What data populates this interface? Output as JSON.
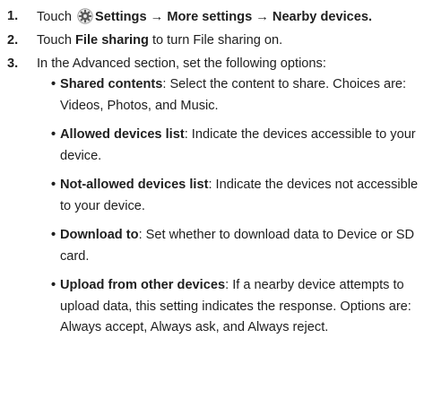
{
  "steps": [
    {
      "number": "1.",
      "parts": [
        "Touch",
        "Settings",
        "→",
        "More settings",
        "→",
        "Nearby devices",
        "."
      ],
      "icon": "settings-gear-icon"
    },
    {
      "number": "2.",
      "parts": [
        "Touch ",
        "File sharing",
        " to turn File sharing on."
      ]
    },
    {
      "number": "3.",
      "text": "In the Advanced section, set the following options:"
    }
  ],
  "options": [
    {
      "title": "Shared contents",
      "desc": ": Select the content to share. Choices are: Videos, Photos, and Music."
    },
    {
      "title": "Allowed devices list",
      "desc": ": Indicate the devices accessible to your device."
    },
    {
      "title": "Not-allowed devices list",
      "desc": ": Indicate the devices not accessible to your device."
    },
    {
      "title": "Download to",
      "desc": ": Set whether to download data to Device or SD card."
    },
    {
      "title": "Upload from other devices",
      "desc": ": If a nearby device attempts to upload data, this setting indicates the response. Options are: Always accept, Always ask, and Always reject."
    }
  ],
  "bullet_char": "•",
  "colors": {
    "text": "#1e1e1e",
    "icon": "#5a5a5a"
  }
}
